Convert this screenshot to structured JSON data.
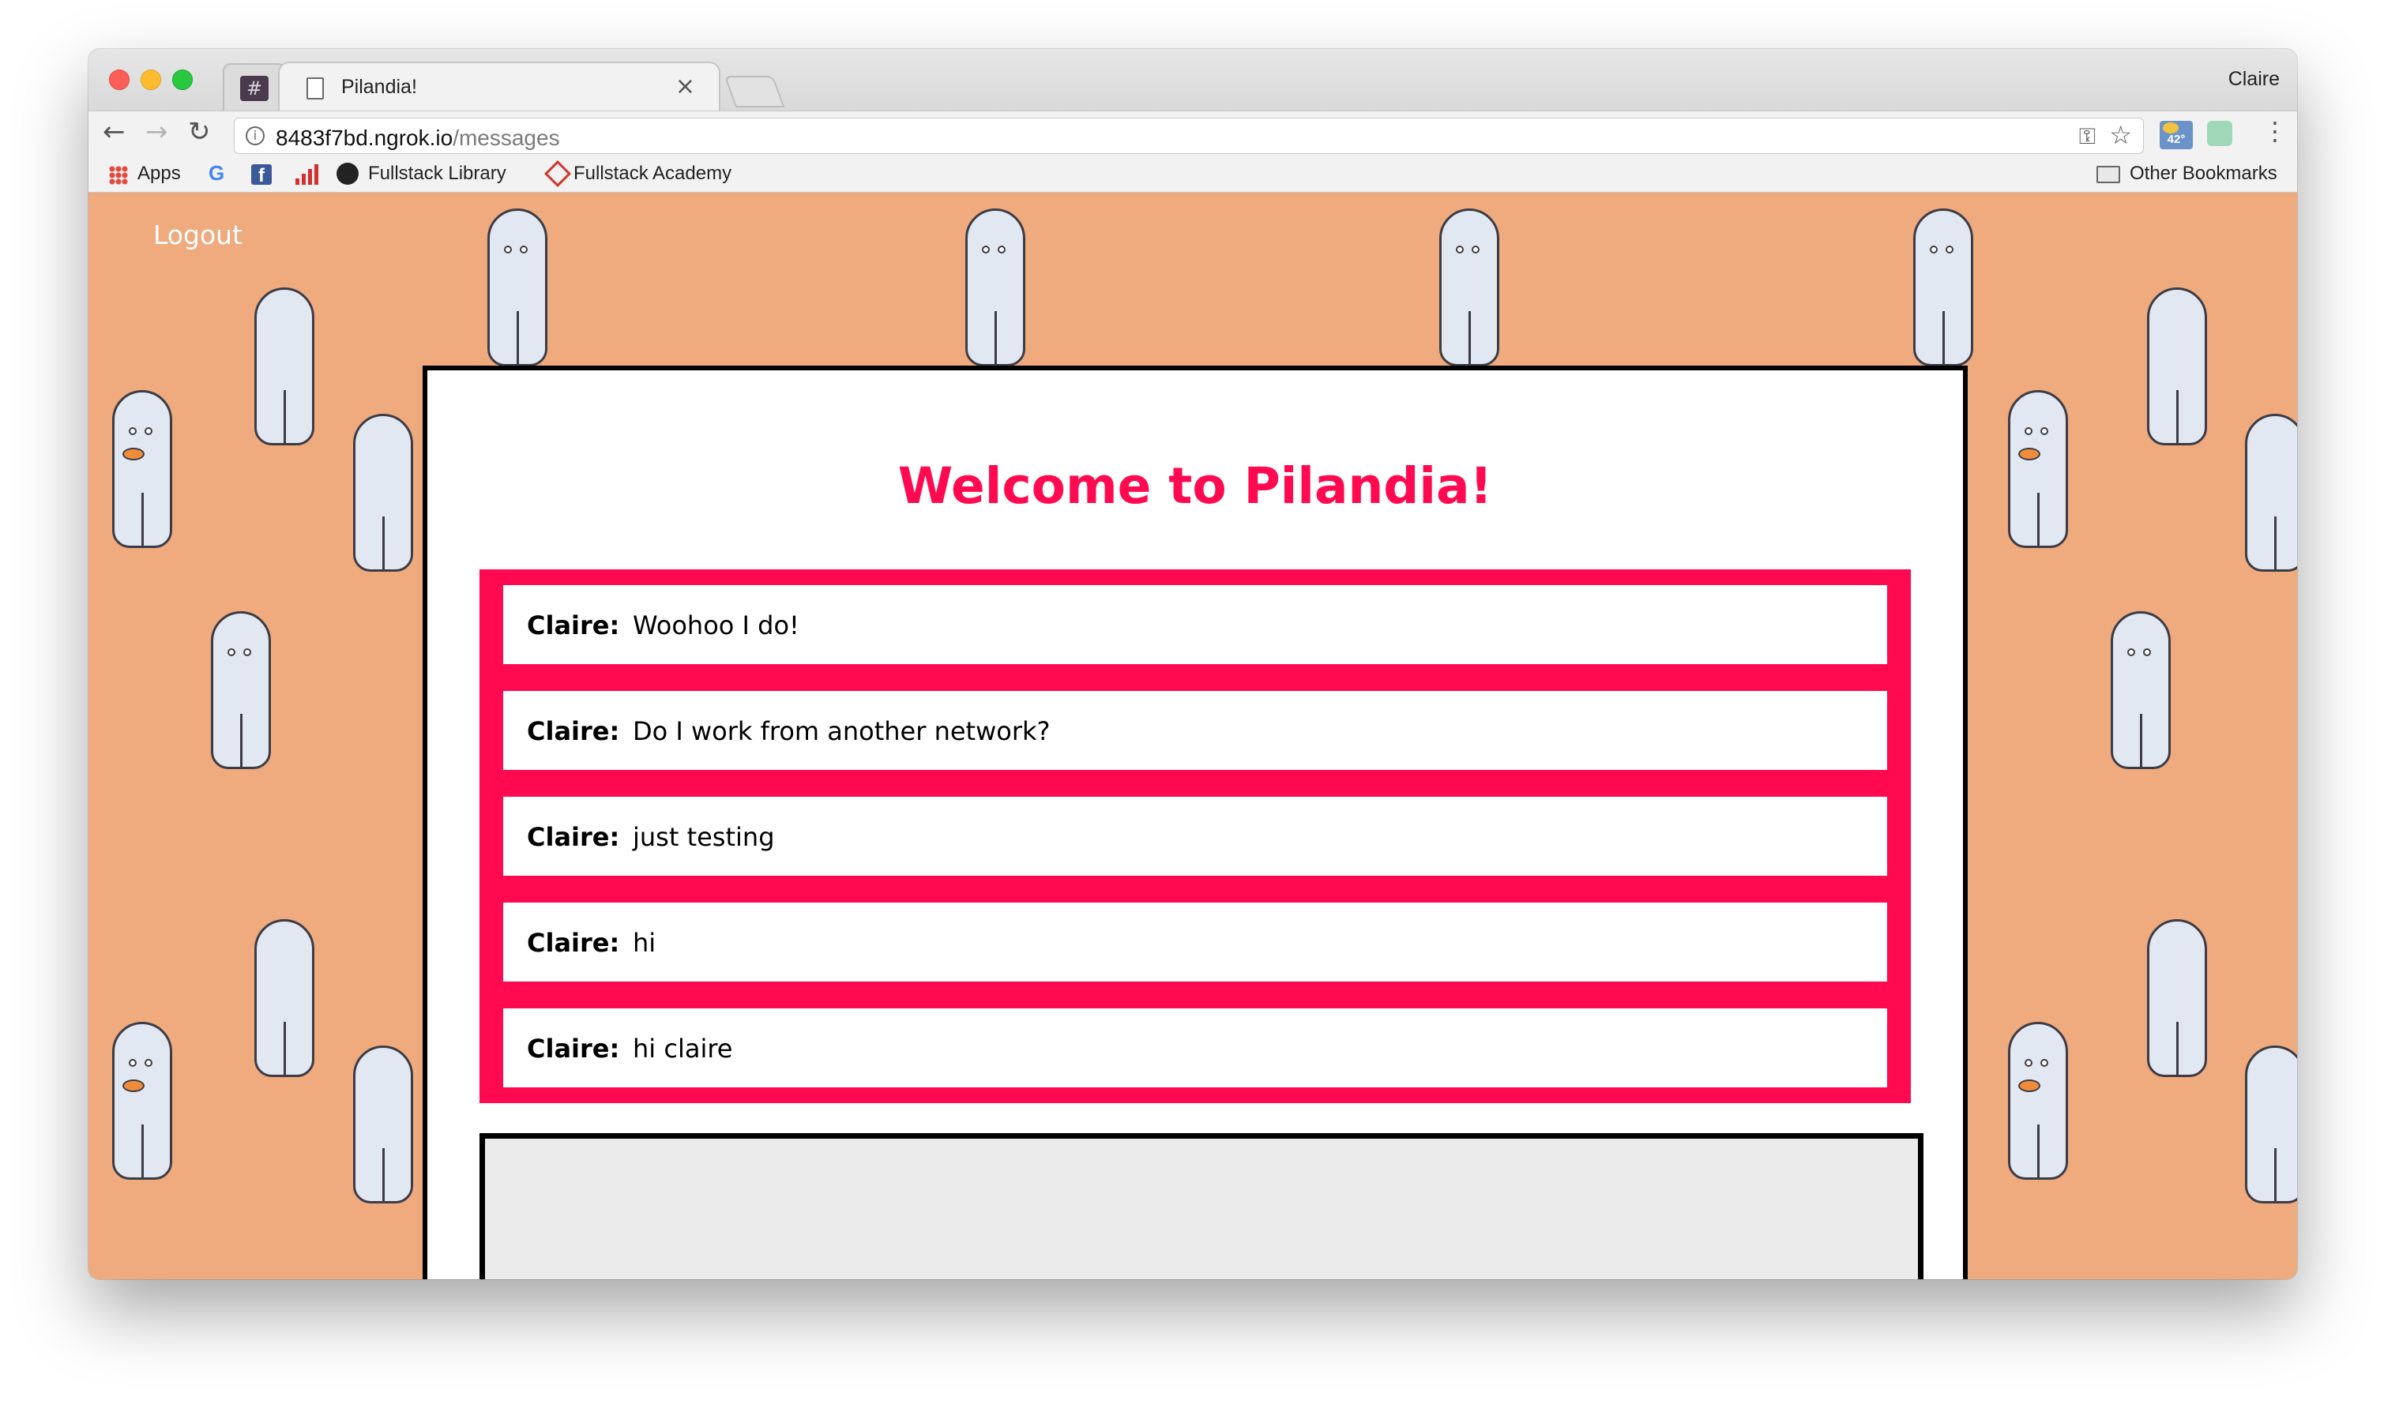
{
  "browser": {
    "pinned_tab_icon": "#",
    "tab_title": "Pilandia!",
    "tab_close": "×",
    "profile_name": "Claire",
    "url_host": "8483f7bd.ngrok.io",
    "url_path": "/messages",
    "weather_temp": "42°",
    "bookmarks": {
      "apps": "Apps",
      "fullstack_library": "Fullstack Library",
      "fullstack_academy": "Fullstack Academy",
      "other_bookmarks": "Other Bookmarks"
    },
    "icons": [
      "back-arrow-icon",
      "forward-arrow-icon",
      "reload-icon",
      "info-icon",
      "key-icon",
      "star-icon",
      "menu-dots-icon"
    ]
  },
  "page": {
    "logout_label": "Logout",
    "heading": "Welcome to Pilandia!",
    "accent_color": "#ff0a50",
    "background_color": "#efaa7e",
    "messages": [
      {
        "author": "Claire:",
        "text": "Woohoo I do!"
      },
      {
        "author": "Claire:",
        "text": "Do I work from another network?"
      },
      {
        "author": "Claire:",
        "text": "just testing"
      },
      {
        "author": "Claire:",
        "text": "hi"
      },
      {
        "author": "Claire:",
        "text": "hi claire"
      }
    ],
    "composer_placeholder": ""
  }
}
